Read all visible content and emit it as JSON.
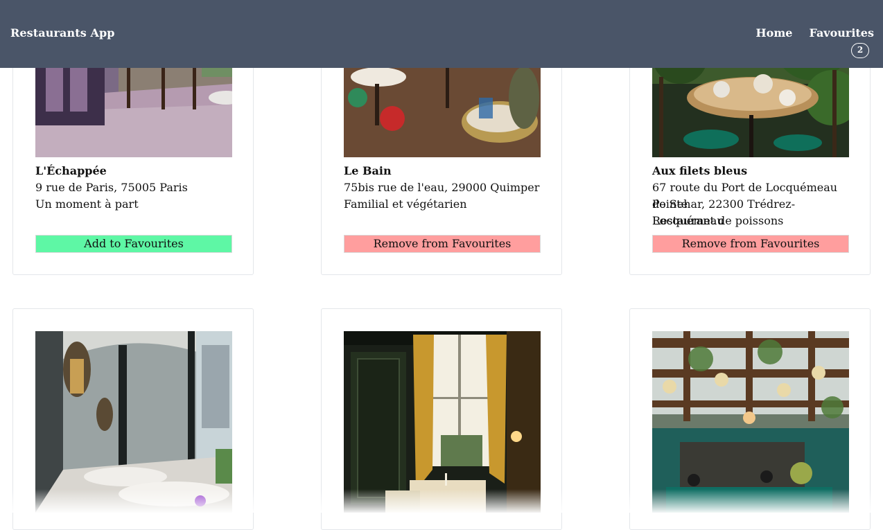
{
  "header": {
    "brand": "Restaurants App",
    "nav": {
      "home": "Home",
      "favourites": "Favourites",
      "favourites_count": "2"
    }
  },
  "restaurants": [
    {
      "name": "L'Échappée",
      "address": "9 rue de Paris, 75005 Paris",
      "description": "Un moment à part",
      "button_label": "Add to Favourites",
      "button_state": "add"
    },
    {
      "name": "Le Bain",
      "address": "75bis rue de l'eau, 29000 Quimper",
      "description": "Familial et végétarien",
      "button_label": "Remove from Favourites",
      "button_state": "remove"
    },
    {
      "name": "Aux filets bleus",
      "address_line1": "67 route du Port de Locquémeau Pointe",
      "address_line2": "de Sehar, 22300 Trédrez-Locquémeau",
      "description": "Restaurant de poissons",
      "button_label": "Remove from Favourites",
      "button_state": "remove"
    },
    {
      "name": "",
      "address": "",
      "description": ""
    },
    {
      "name": "",
      "address": "",
      "description": ""
    },
    {
      "name": "",
      "address": "",
      "description": ""
    }
  ],
  "colors": {
    "header_bg": "#4a5568",
    "add_button": "#5ef7a5",
    "remove_button": "#ff9e9e"
  }
}
